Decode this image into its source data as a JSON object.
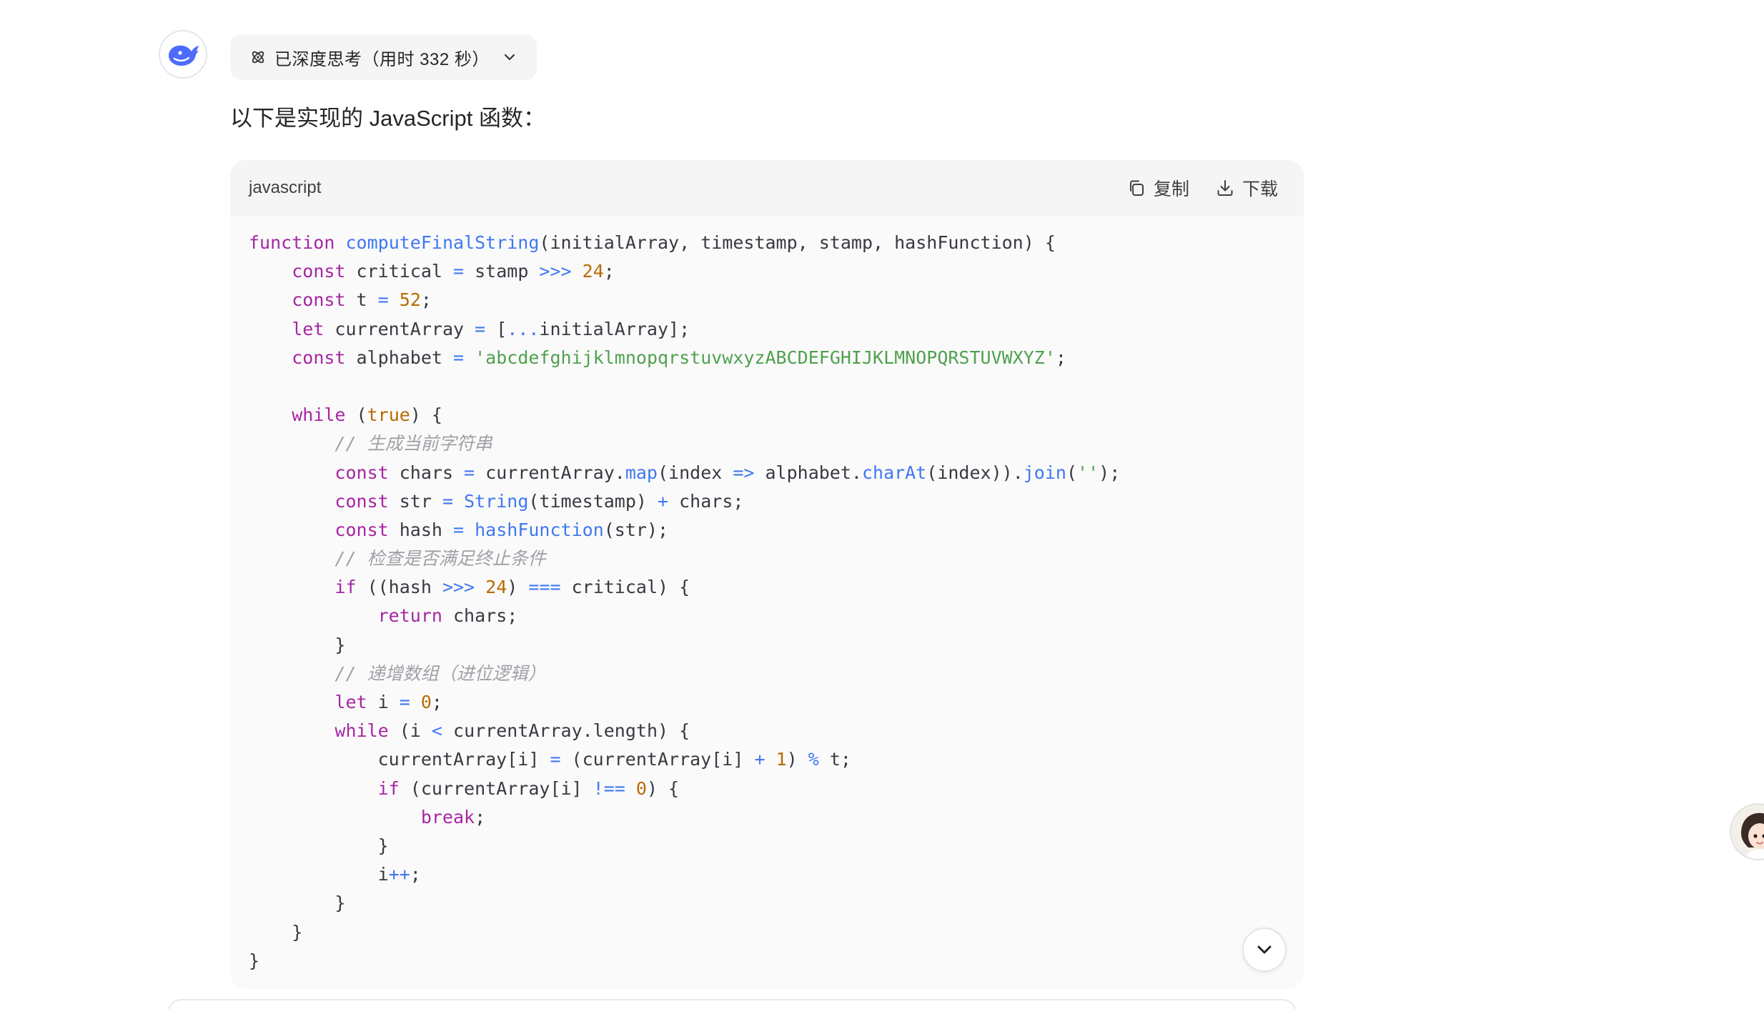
{
  "assistant": {
    "avatar_icon": "deepseek-whale-icon",
    "brand_color": "#4d6bfe"
  },
  "thinking": {
    "label": "已深度思考（用时 332 秒）",
    "icon": "atom-icon",
    "toggle_icon": "chevron-down-icon"
  },
  "message": {
    "intro": "以下是实现的 JavaScript 函数："
  },
  "code_block": {
    "language": "javascript",
    "copy_label": "复制",
    "download_label": "下载",
    "lines": [
      [
        {
          "t": "function",
          "c": "kw"
        },
        {
          "t": " "
        },
        {
          "t": "computeFinalString",
          "c": "fn"
        },
        {
          "t": "(initialArray, timestamp, stamp, hashFunction) {"
        }
      ],
      [
        {
          "t": "    "
        },
        {
          "t": "const",
          "c": "kw"
        },
        {
          "t": " critical "
        },
        {
          "t": "=",
          "c": "op"
        },
        {
          "t": " stamp "
        },
        {
          "t": ">>>",
          "c": "op"
        },
        {
          "t": " "
        },
        {
          "t": "24",
          "c": "num"
        },
        {
          "t": ";"
        }
      ],
      [
        {
          "t": "    "
        },
        {
          "t": "const",
          "c": "kw"
        },
        {
          "t": " t "
        },
        {
          "t": "=",
          "c": "op"
        },
        {
          "t": " "
        },
        {
          "t": "52",
          "c": "num"
        },
        {
          "t": ";"
        }
      ],
      [
        {
          "t": "    "
        },
        {
          "t": "let",
          "c": "kw"
        },
        {
          "t": " currentArray "
        },
        {
          "t": "=",
          "c": "op"
        },
        {
          "t": " ["
        },
        {
          "t": "...",
          "c": "op"
        },
        {
          "t": "initialArray];"
        }
      ],
      [
        {
          "t": "    "
        },
        {
          "t": "const",
          "c": "kw"
        },
        {
          "t": " alphabet "
        },
        {
          "t": "=",
          "c": "op"
        },
        {
          "t": " "
        },
        {
          "t": "'abcdefghijklmnopqrstuvwxyzABCDEFGHIJKLMNOPQRSTUVWXYZ'",
          "c": "str"
        },
        {
          "t": ";"
        }
      ],
      [
        {
          "t": ""
        }
      ],
      [
        {
          "t": "    "
        },
        {
          "t": "while",
          "c": "kw"
        },
        {
          "t": " ("
        },
        {
          "t": "true",
          "c": "num"
        },
        {
          "t": ") {"
        }
      ],
      [
        {
          "t": "        "
        },
        {
          "t": "// 生成当前字符串",
          "c": "cm"
        }
      ],
      [
        {
          "t": "        "
        },
        {
          "t": "const",
          "c": "kw"
        },
        {
          "t": " chars "
        },
        {
          "t": "=",
          "c": "op"
        },
        {
          "t": " currentArray."
        },
        {
          "t": "map",
          "c": "fn"
        },
        {
          "t": "(index "
        },
        {
          "t": "=>",
          "c": "op"
        },
        {
          "t": " alphabet."
        },
        {
          "t": "charAt",
          "c": "fn"
        },
        {
          "t": "(index))."
        },
        {
          "t": "join",
          "c": "fn"
        },
        {
          "t": "("
        },
        {
          "t": "''",
          "c": "str"
        },
        {
          "t": ");"
        }
      ],
      [
        {
          "t": "        "
        },
        {
          "t": "const",
          "c": "kw"
        },
        {
          "t": " str "
        },
        {
          "t": "=",
          "c": "op"
        },
        {
          "t": " "
        },
        {
          "t": "String",
          "c": "fn"
        },
        {
          "t": "(timestamp) "
        },
        {
          "t": "+",
          "c": "op"
        },
        {
          "t": " chars;"
        }
      ],
      [
        {
          "t": "        "
        },
        {
          "t": "const",
          "c": "kw"
        },
        {
          "t": " hash "
        },
        {
          "t": "=",
          "c": "op"
        },
        {
          "t": " "
        },
        {
          "t": "hashFunction",
          "c": "fn"
        },
        {
          "t": "(str);"
        }
      ],
      [
        {
          "t": "        "
        },
        {
          "t": "// 检查是否满足终止条件",
          "c": "cm"
        }
      ],
      [
        {
          "t": "        "
        },
        {
          "t": "if",
          "c": "kw"
        },
        {
          "t": " ((hash "
        },
        {
          "t": ">>>",
          "c": "op"
        },
        {
          "t": " "
        },
        {
          "t": "24",
          "c": "num"
        },
        {
          "t": ") "
        },
        {
          "t": "===",
          "c": "op"
        },
        {
          "t": " critical) {"
        }
      ],
      [
        {
          "t": "            "
        },
        {
          "t": "return",
          "c": "kw"
        },
        {
          "t": " chars;"
        }
      ],
      [
        {
          "t": "        }"
        }
      ],
      [
        {
          "t": "        "
        },
        {
          "t": "// 递增数组（进位逻辑）",
          "c": "cm"
        }
      ],
      [
        {
          "t": "        "
        },
        {
          "t": "let",
          "c": "kw"
        },
        {
          "t": " i "
        },
        {
          "t": "=",
          "c": "op"
        },
        {
          "t": " "
        },
        {
          "t": "0",
          "c": "num"
        },
        {
          "t": ";"
        }
      ],
      [
        {
          "t": "        "
        },
        {
          "t": "while",
          "c": "kw"
        },
        {
          "t": " (i "
        },
        {
          "t": "<",
          "c": "op"
        },
        {
          "t": " currentArray.length) {"
        }
      ],
      [
        {
          "t": "            currentArray[i] "
        },
        {
          "t": "=",
          "c": "op"
        },
        {
          "t": " (currentArray[i] "
        },
        {
          "t": "+",
          "c": "op"
        },
        {
          "t": " "
        },
        {
          "t": "1",
          "c": "num"
        },
        {
          "t": ") "
        },
        {
          "t": "%",
          "c": "op"
        },
        {
          "t": " t;"
        }
      ],
      [
        {
          "t": "            "
        },
        {
          "t": "if",
          "c": "kw"
        },
        {
          "t": " (currentArray[i] "
        },
        {
          "t": "!==",
          "c": "op"
        },
        {
          "t": " "
        },
        {
          "t": "0",
          "c": "num"
        },
        {
          "t": ") {"
        }
      ],
      [
        {
          "t": "                "
        },
        {
          "t": "break",
          "c": "kw"
        },
        {
          "t": ";"
        }
      ],
      [
        {
          "t": "            }"
        }
      ],
      [
        {
          "t": "            i"
        },
        {
          "t": "++",
          "c": "op"
        },
        {
          "t": ";"
        }
      ],
      [
        {
          "t": "        }"
        }
      ],
      [
        {
          "t": "    }"
        }
      ],
      [
        {
          "t": "}"
        }
      ]
    ]
  },
  "scroll_button": {
    "icon": "chevron-down-icon"
  },
  "side_widget": {
    "icon": "user-avatar-icon"
  }
}
